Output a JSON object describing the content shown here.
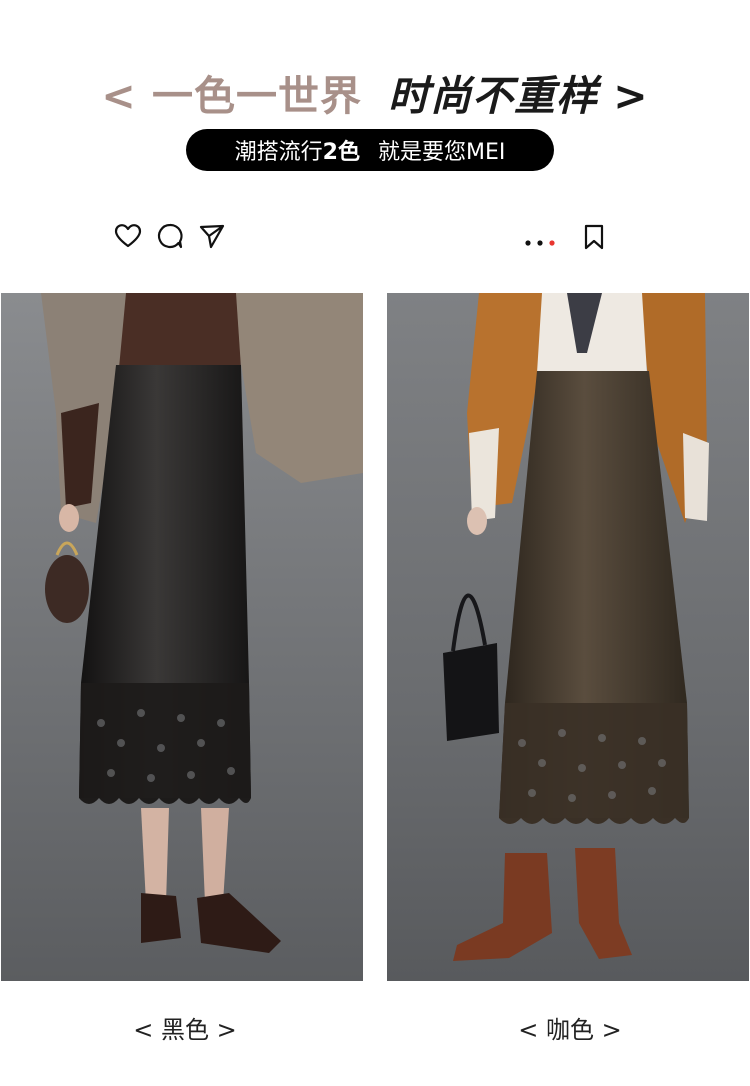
{
  "header": {
    "title_left": "< 一色一世界",
    "title_right": "时尚不重样 >",
    "pill_part1": "潮搭流行",
    "pill_bold": "2色",
    "pill_part2": "就是要您MEI"
  },
  "social_bar": {
    "icons": [
      "heart-icon",
      "comment-icon",
      "send-icon",
      "more-dots-icon",
      "bookmark-icon"
    ],
    "accent_dot_color": "#e8362f"
  },
  "products": [
    {
      "caption": "< 黑色 >",
      "skirt_color": "#1c1a19"
    },
    {
      "caption": "< 咖色 >",
      "skirt_color": "#3e3428"
    }
  ]
}
